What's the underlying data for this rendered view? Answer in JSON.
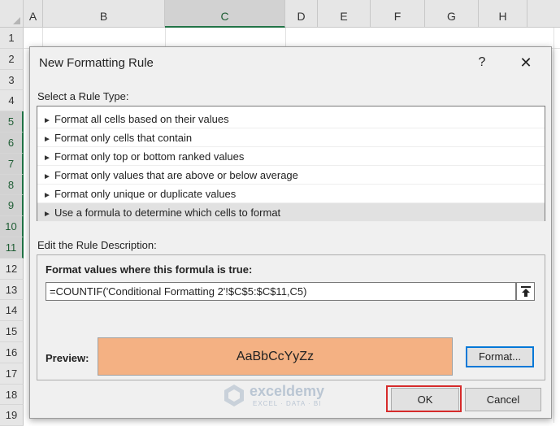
{
  "sheet": {
    "columns": [
      "A",
      "B",
      "C",
      "D",
      "E",
      "F",
      "G",
      "H"
    ],
    "selected_column": "C",
    "rows": [
      "1",
      "2",
      "3",
      "4",
      "5",
      "6",
      "7",
      "8",
      "9",
      "10",
      "11",
      "12",
      "13",
      "14",
      "15",
      "16",
      "17",
      "18",
      "19"
    ],
    "selected_rows": [
      "5",
      "6",
      "7",
      "8",
      "9",
      "10",
      "11"
    ],
    "accent_color": "#217346"
  },
  "dialog": {
    "title": "New Formatting Rule",
    "help_label": "?",
    "close_label": "✕",
    "rule_type_label": "Select a Rule Type:",
    "rule_types": [
      {
        "label": "Format all cells based on their values",
        "selected": false
      },
      {
        "label": "Format only cells that contain",
        "selected": false
      },
      {
        "label": "Format only top or bottom ranked values",
        "selected": false
      },
      {
        "label": "Format only values that are above or below average",
        "selected": false
      },
      {
        "label": "Format only unique or duplicate values",
        "selected": false
      },
      {
        "label": "Use a formula to determine which cells to format",
        "selected": true
      }
    ],
    "rule_arrow": "►",
    "description_label": "Edit the Rule Description:",
    "formula_heading": "Format values where this formula is true:",
    "formula_value": "=COUNTIF('Conditional Formatting 2'!$C$5:$C$11,C5)",
    "preview_label": "Preview:",
    "preview_text": "AaBbCcYyZz",
    "preview_fill_color": "#f4b183",
    "format_button": "Format...",
    "ok_button": "OK",
    "cancel_button": "Cancel",
    "highlight_color": "#d62b2b"
  },
  "watermark": {
    "brand": "exceldemy",
    "tagline": "EXCEL · DATA · BI",
    "icon": "exceldemy-logo-icon"
  }
}
